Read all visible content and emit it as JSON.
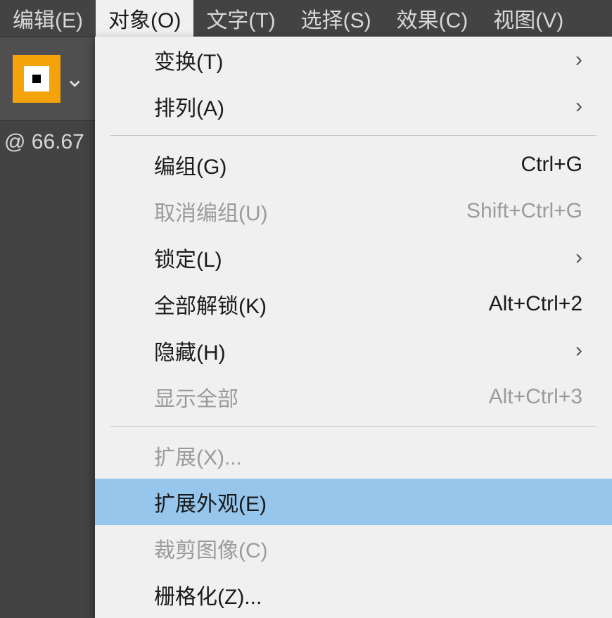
{
  "menubar": {
    "edit": "编辑(E)",
    "object": "对象(O)",
    "type": "文字(T)",
    "select": "选择(S)",
    "effect": "效果(C)",
    "view": "视图(V)"
  },
  "tab": {
    "zoom_label": "@ 66.67"
  },
  "dropdown": {
    "transform": {
      "label": "变换(T)"
    },
    "arrange": {
      "label": "排列(A)"
    },
    "group": {
      "label": "编组(G)",
      "shortcut": "Ctrl+G"
    },
    "ungroup": {
      "label": "取消编组(U)",
      "shortcut": "Shift+Ctrl+G"
    },
    "lock": {
      "label": "锁定(L)"
    },
    "unlock_all": {
      "label": "全部解锁(K)",
      "shortcut": "Alt+Ctrl+2"
    },
    "hide": {
      "label": "隐藏(H)"
    },
    "show_all": {
      "label": "显示全部",
      "shortcut": "Alt+Ctrl+3"
    },
    "expand": {
      "label": "扩展(X)..."
    },
    "expand_appearance": {
      "label": "扩展外观(E)"
    },
    "crop_image": {
      "label": "裁剪图像(C)"
    },
    "rasterize": {
      "label": "栅格化(Z)..."
    }
  }
}
